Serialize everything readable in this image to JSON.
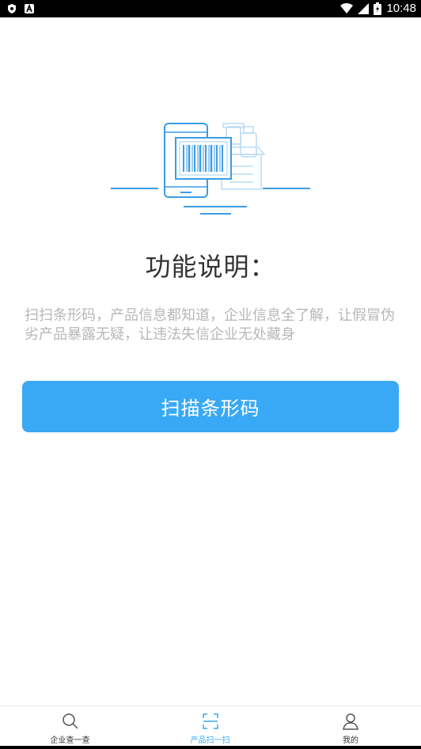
{
  "status_bar": {
    "time": "10:48",
    "icons": [
      "shield-icon",
      "a-icon",
      "wifi-icon",
      "signal-icon",
      "battery-icon"
    ]
  },
  "main": {
    "title": "功能说明：",
    "description": "扫扫条形码，产品信息都知道，企业信息全了解，让假冒伪劣产品暴露无疑，让违法失信企业无处藏身",
    "scan_button_label": "扫描条形码"
  },
  "tabs": [
    {
      "label": "企业查一查",
      "icon": "search-icon",
      "active": false
    },
    {
      "label": "产品扫一扫",
      "icon": "scan-icon",
      "active": true
    },
    {
      "label": "我的",
      "icon": "person-icon",
      "active": false
    }
  ],
  "colors": {
    "accent": "#3aa9f5",
    "title": "#333333",
    "description": "#b7b7b7",
    "illustration_line": "#3a9de6"
  }
}
